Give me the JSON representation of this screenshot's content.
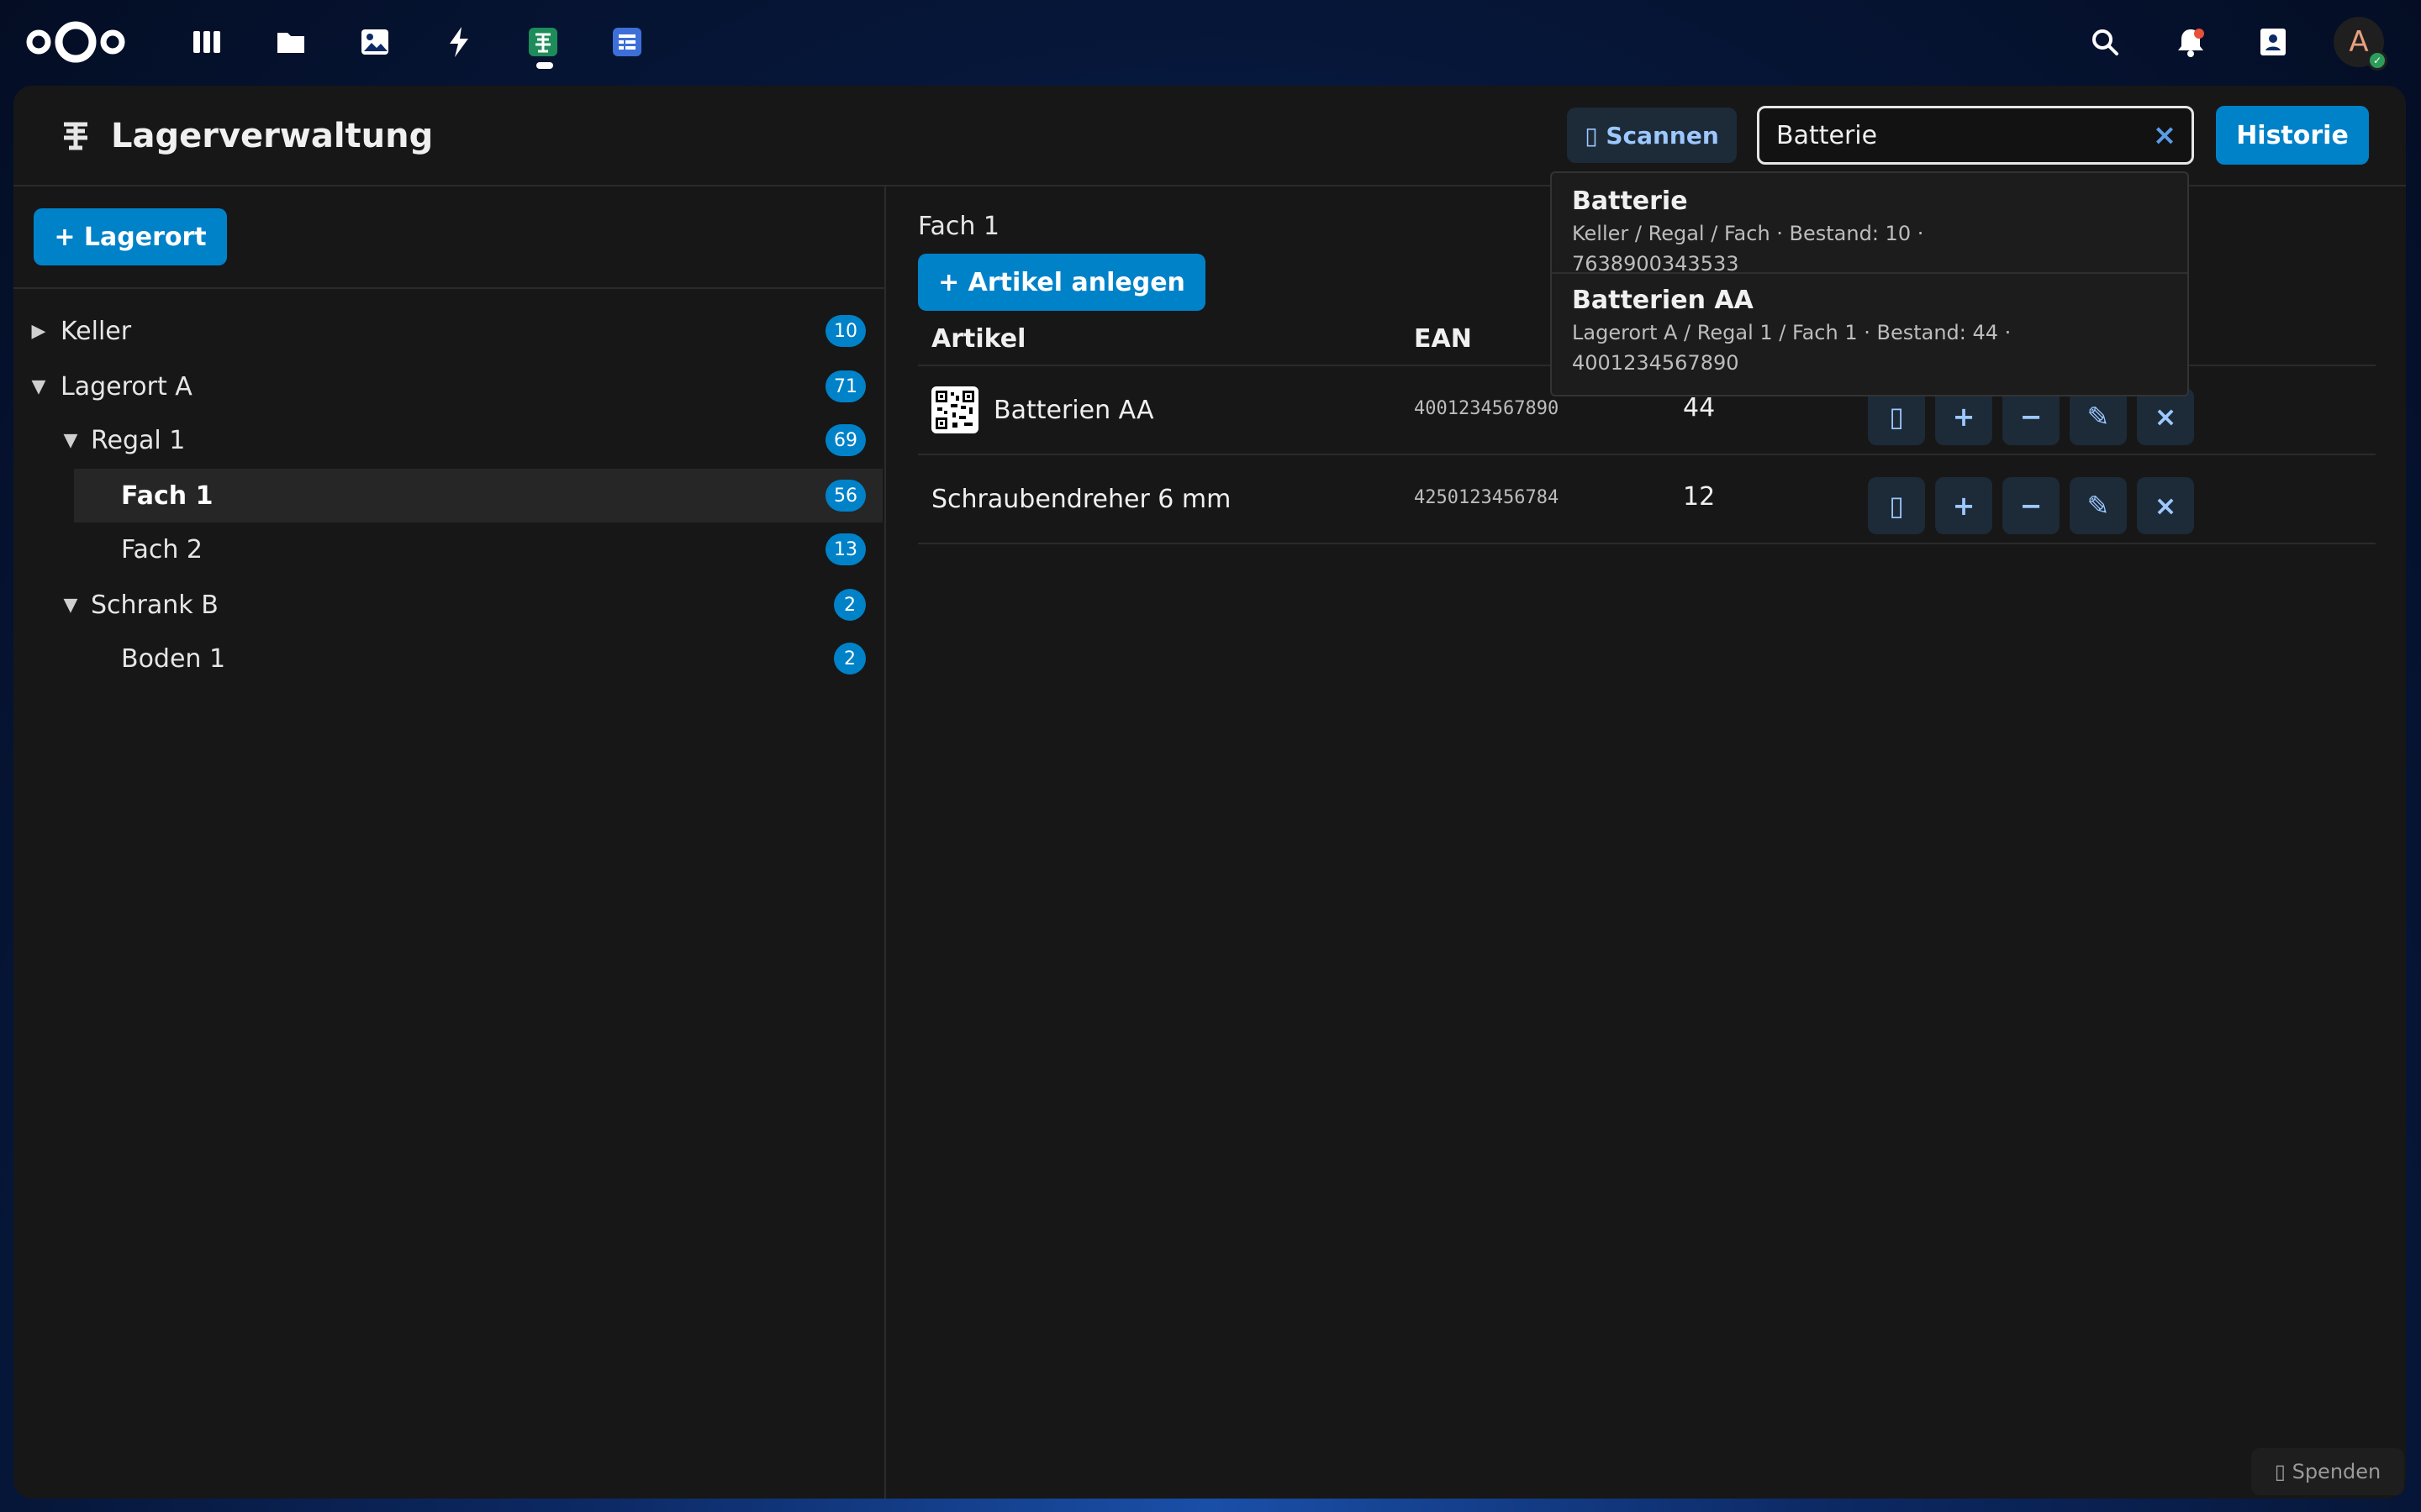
{
  "topbar": {
    "apps": [
      {
        "icon": "dashboard-icon"
      },
      {
        "icon": "files-icon"
      },
      {
        "icon": "photos-icon"
      },
      {
        "icon": "activity-icon"
      },
      {
        "icon": "inventory-app-icon",
        "active": true
      },
      {
        "icon": "forms-app-icon"
      }
    ],
    "avatar_initial": "A"
  },
  "header": {
    "title": "Lagerverwaltung",
    "scan_label": "▯ Scannen",
    "search_value": "Batterie",
    "search_clear": "×",
    "history_label": "Historie"
  },
  "sidebar": {
    "add_location_label": "+ Lagerort",
    "items": [
      {
        "label": "Keller",
        "count": "10",
        "toggle": "▶"
      },
      {
        "label": "Lagerort A",
        "count": "71",
        "toggle": "▼"
      },
      {
        "label": "Regal 1",
        "count": "69",
        "toggle": "▼"
      },
      {
        "label": "Fach 1",
        "count": "56",
        "toggle": ""
      },
      {
        "label": "Fach 2",
        "count": "13",
        "toggle": ""
      },
      {
        "label": "Schrank B",
        "count": "2",
        "toggle": "▼"
      },
      {
        "label": "Boden 1",
        "count": "2",
        "toggle": ""
      }
    ]
  },
  "content": {
    "breadcrumb": "Fach 1",
    "add_item_label": "+ Artikel anlegen",
    "columns": {
      "article": "Artikel",
      "ean": "EAN"
    },
    "rows": [
      {
        "name": "Batterien AA",
        "ean": "4001234567890",
        "stock": "44",
        "has_qr": true
      },
      {
        "name": "Schraubendreher 6 mm",
        "ean": "4250123456784",
        "stock": "12",
        "has_qr": false
      }
    ],
    "action_labels": {
      "scan": "▯",
      "plus": "+",
      "minus": "−",
      "edit": "✎",
      "delete": "×"
    }
  },
  "dropdown": {
    "results": [
      {
        "title": "Batterie",
        "sub": "Keller / Regal / Fach · Bestand: 10 · 7638900343533"
      },
      {
        "title": "Batterien AA",
        "sub": "Lagerort A / Regal 1 / Fach 1 · Bestand: 44 · 4001234567890"
      }
    ]
  },
  "footer": {
    "donate_label": "▯ Spenden"
  },
  "colors": {
    "accent": "#0082c9",
    "background": "#171717",
    "badge": "#0082c9"
  }
}
